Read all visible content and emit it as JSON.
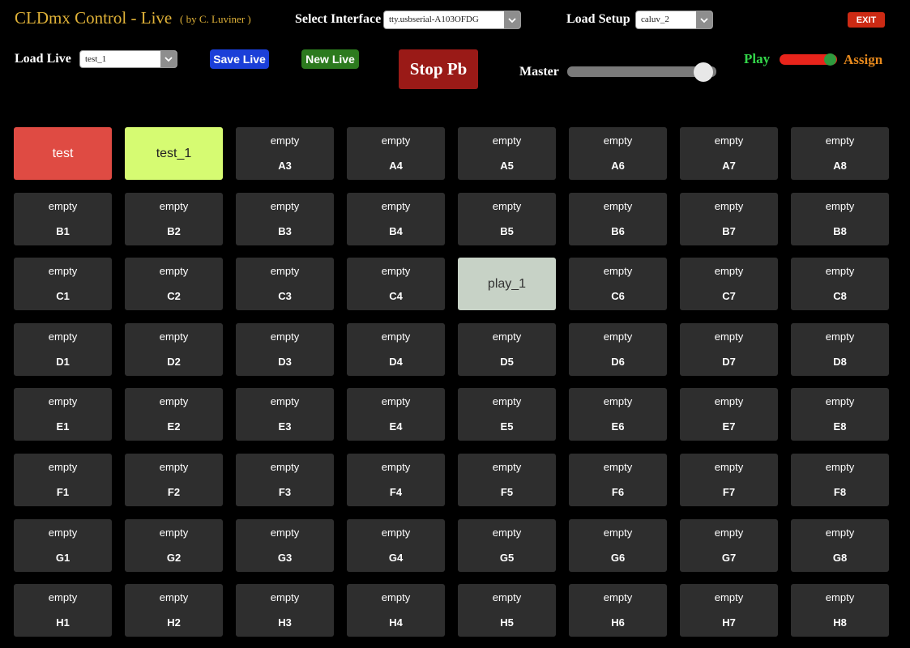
{
  "header": {
    "title": "CLDmx Control - Live",
    "byline": "( by C. Luviner )",
    "select_interface_label": "Select Interface",
    "interface_value": "tty.usbserial-A103OFDG",
    "load_setup_label": "Load Setup",
    "setup_value": "caluv_2",
    "exit_label": "EXIT"
  },
  "controls": {
    "load_live_label": "Load Live",
    "live_value": "test_1",
    "save_live_label": "Save Live",
    "new_live_label": "New Live",
    "stop_pb_label": "Stop Pb",
    "master_label": "Master",
    "master_level": 1.0,
    "play_label": "Play",
    "assign_label": "Assign",
    "mode": "play"
  },
  "colors": {
    "title": "#e0b238",
    "cell": "#2e2e2e",
    "cell_active_red": "#df4b43",
    "cell_selected_lime": "#d6fb72",
    "cell_pale": "#c7d2c6"
  },
  "grid": {
    "rows": [
      [
        {
          "name": "test",
          "style": "red"
        },
        {
          "name": "test_1",
          "style": "lime"
        },
        {
          "top": "empty",
          "id": "A3"
        },
        {
          "top": "empty",
          "id": "A4"
        },
        {
          "top": "empty",
          "id": "A5"
        },
        {
          "top": "empty",
          "id": "A6"
        },
        {
          "top": "empty",
          "id": "A7"
        },
        {
          "top": "empty",
          "id": "A8"
        }
      ],
      [
        {
          "top": "empty",
          "id": "B1"
        },
        {
          "top": "empty",
          "id": "B2"
        },
        {
          "top": "empty",
          "id": "B3"
        },
        {
          "top": "empty",
          "id": "B4"
        },
        {
          "top": "empty",
          "id": "B5"
        },
        {
          "top": "empty",
          "id": "B6"
        },
        {
          "top": "empty",
          "id": "B7"
        },
        {
          "top": "empty",
          "id": "B8"
        }
      ],
      [
        {
          "top": "empty",
          "id": "C1"
        },
        {
          "top": "empty",
          "id": "C2"
        },
        {
          "top": "empty",
          "id": "C3"
        },
        {
          "top": "empty",
          "id": "C4"
        },
        {
          "name": "play_1",
          "style": "pale"
        },
        {
          "top": "empty",
          "id": "C6"
        },
        {
          "top": "empty",
          "id": "C7"
        },
        {
          "top": "empty",
          "id": "C8"
        }
      ],
      [
        {
          "top": "empty",
          "id": "D1"
        },
        {
          "top": "empty",
          "id": "D2"
        },
        {
          "top": "empty",
          "id": "D3"
        },
        {
          "top": "empty",
          "id": "D4"
        },
        {
          "top": "empty",
          "id": "D5"
        },
        {
          "top": "empty",
          "id": "D6"
        },
        {
          "top": "empty",
          "id": "D7"
        },
        {
          "top": "empty",
          "id": "D8"
        }
      ],
      [
        {
          "top": "empty",
          "id": "E1"
        },
        {
          "top": "empty",
          "id": "E2"
        },
        {
          "top": "empty",
          "id": "E3"
        },
        {
          "top": "empty",
          "id": "E4"
        },
        {
          "top": "empty",
          "id": "E5"
        },
        {
          "top": "empty",
          "id": "E6"
        },
        {
          "top": "empty",
          "id": "E7"
        },
        {
          "top": "empty",
          "id": "E8"
        }
      ],
      [
        {
          "top": "empty",
          "id": "F1"
        },
        {
          "top": "empty",
          "id": "F2"
        },
        {
          "top": "empty",
          "id": "F3"
        },
        {
          "top": "empty",
          "id": "F4"
        },
        {
          "top": "empty",
          "id": "F5"
        },
        {
          "top": "empty",
          "id": "F6"
        },
        {
          "top": "empty",
          "id": "F7"
        },
        {
          "top": "empty",
          "id": "F8"
        }
      ],
      [
        {
          "top": "empty",
          "id": "G1"
        },
        {
          "top": "empty",
          "id": "G2"
        },
        {
          "top": "empty",
          "id": "G3"
        },
        {
          "top": "empty",
          "id": "G4"
        },
        {
          "top": "empty",
          "id": "G5"
        },
        {
          "top": "empty",
          "id": "G6"
        },
        {
          "top": "empty",
          "id": "G7"
        },
        {
          "top": "empty",
          "id": "G8"
        }
      ],
      [
        {
          "top": "empty",
          "id": "H1"
        },
        {
          "top": "empty",
          "id": "H2"
        },
        {
          "top": "empty",
          "id": "H3"
        },
        {
          "top": "empty",
          "id": "H4"
        },
        {
          "top": "empty",
          "id": "H5"
        },
        {
          "top": "empty",
          "id": "H6"
        },
        {
          "top": "empty",
          "id": "H7"
        },
        {
          "top": "empty",
          "id": "H8"
        }
      ]
    ]
  }
}
